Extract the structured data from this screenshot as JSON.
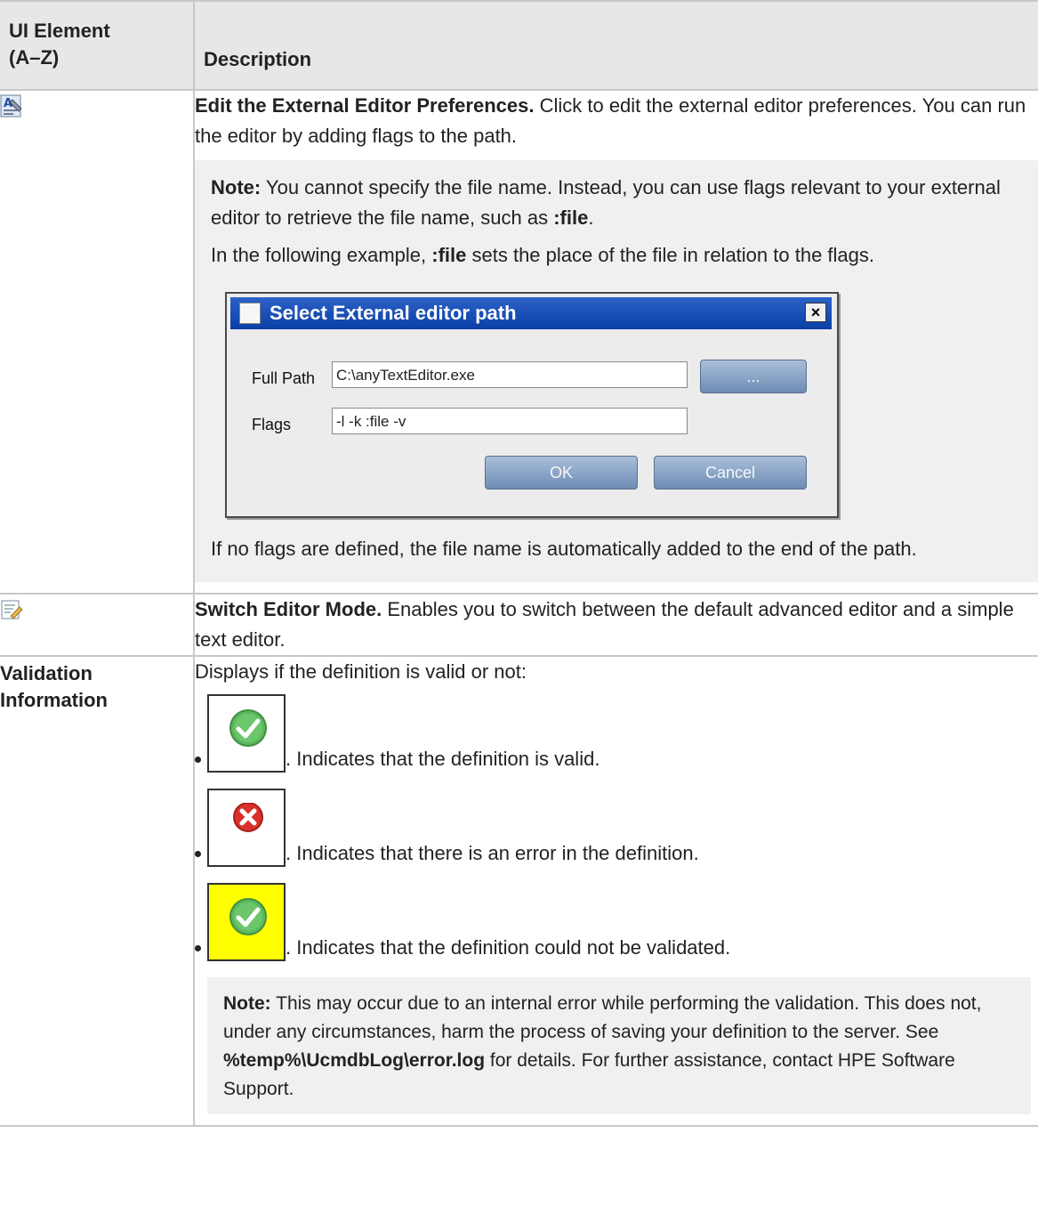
{
  "header": {
    "col1_line1": "UI Element",
    "col1_line2": "(A–Z)",
    "col2": "Description"
  },
  "rows": [
    {
      "icon": "edit-external-editor-icon",
      "title": "Edit the External Editor Preferences.",
      "text": " Click to edit the external editor preferences. You can run the editor by adding flags to the path.",
      "note": {
        "label": "Note:",
        "text1": " You cannot specify the file name. Instead, you can use flags relevant to your external editor to retrieve the file name, such as ",
        "flag": ":file",
        "text1_end": ".",
        "p2_start": "In the following example, ",
        "p2_flag": ":file",
        "p2_end": " sets the place of the file in relation to the flags.",
        "dialog": {
          "title": "Select External editor path",
          "close": "×",
          "full_path_label": "Full Path",
          "full_path_value": "C:\\anyTextEditor.exe",
          "browse": "...",
          "flags_label": "Flags",
          "flags_value": "-l -k :file -v",
          "ok": "OK",
          "cancel": "Cancel"
        },
        "after": "If no flags are defined, the file name is automatically added to the end of the path."
      }
    },
    {
      "icon": "switch-editor-mode-icon",
      "title": "Switch Editor Mode.",
      "text": " Enables you to switch between the default advanced editor and a simple text editor."
    },
    {
      "label": "Validation Information",
      "intro": "Displays if the definition is valid or not:",
      "items": [
        {
          "icon": "valid-check-icon",
          "text": ". Indicates that the definition is valid."
        },
        {
          "icon": "error-x-icon",
          "text": ". Indicates that there is an error in the definition."
        },
        {
          "icon": "not-validated-icon",
          "text": ". Indicates that the definition could not be validated."
        }
      ],
      "note": {
        "label": "Note:",
        "text1": " This may occur due to an internal error while performing the validation. This does not, under any circumstances, harm the process of saving your definition to the server. See ",
        "path": "%temp%\\UcmdbLog\\error.log",
        "text2": " for details. For further assistance, contact HPE Software Support."
      }
    }
  ],
  "colors": {
    "header_bg": "#e7e7e7",
    "note_bg": "#f0f0f0",
    "title_bar": "#0a3fa5",
    "valid_green": "#5cb85c",
    "error_red": "#d9302a",
    "warn_yellow": "#ffff00"
  }
}
